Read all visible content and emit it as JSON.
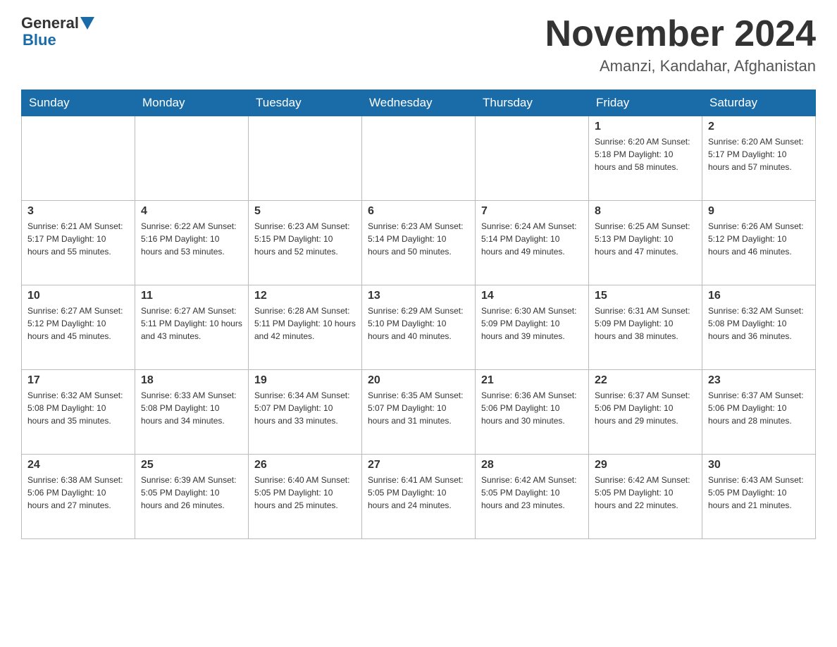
{
  "header": {
    "logo_general": "General",
    "logo_blue": "Blue",
    "month_title": "November 2024",
    "location": "Amanzi, Kandahar, Afghanistan"
  },
  "weekdays": [
    "Sunday",
    "Monday",
    "Tuesday",
    "Wednesday",
    "Thursday",
    "Friday",
    "Saturday"
  ],
  "weeks": [
    [
      {
        "day": "",
        "info": ""
      },
      {
        "day": "",
        "info": ""
      },
      {
        "day": "",
        "info": ""
      },
      {
        "day": "",
        "info": ""
      },
      {
        "day": "",
        "info": ""
      },
      {
        "day": "1",
        "info": "Sunrise: 6:20 AM\nSunset: 5:18 PM\nDaylight: 10 hours and 58 minutes."
      },
      {
        "day": "2",
        "info": "Sunrise: 6:20 AM\nSunset: 5:17 PM\nDaylight: 10 hours and 57 minutes."
      }
    ],
    [
      {
        "day": "3",
        "info": "Sunrise: 6:21 AM\nSunset: 5:17 PM\nDaylight: 10 hours and 55 minutes."
      },
      {
        "day": "4",
        "info": "Sunrise: 6:22 AM\nSunset: 5:16 PM\nDaylight: 10 hours and 53 minutes."
      },
      {
        "day": "5",
        "info": "Sunrise: 6:23 AM\nSunset: 5:15 PM\nDaylight: 10 hours and 52 minutes."
      },
      {
        "day": "6",
        "info": "Sunrise: 6:23 AM\nSunset: 5:14 PM\nDaylight: 10 hours and 50 minutes."
      },
      {
        "day": "7",
        "info": "Sunrise: 6:24 AM\nSunset: 5:14 PM\nDaylight: 10 hours and 49 minutes."
      },
      {
        "day": "8",
        "info": "Sunrise: 6:25 AM\nSunset: 5:13 PM\nDaylight: 10 hours and 47 minutes."
      },
      {
        "day": "9",
        "info": "Sunrise: 6:26 AM\nSunset: 5:12 PM\nDaylight: 10 hours and 46 minutes."
      }
    ],
    [
      {
        "day": "10",
        "info": "Sunrise: 6:27 AM\nSunset: 5:12 PM\nDaylight: 10 hours and 45 minutes."
      },
      {
        "day": "11",
        "info": "Sunrise: 6:27 AM\nSunset: 5:11 PM\nDaylight: 10 hours and 43 minutes."
      },
      {
        "day": "12",
        "info": "Sunrise: 6:28 AM\nSunset: 5:11 PM\nDaylight: 10 hours and 42 minutes."
      },
      {
        "day": "13",
        "info": "Sunrise: 6:29 AM\nSunset: 5:10 PM\nDaylight: 10 hours and 40 minutes."
      },
      {
        "day": "14",
        "info": "Sunrise: 6:30 AM\nSunset: 5:09 PM\nDaylight: 10 hours and 39 minutes."
      },
      {
        "day": "15",
        "info": "Sunrise: 6:31 AM\nSunset: 5:09 PM\nDaylight: 10 hours and 38 minutes."
      },
      {
        "day": "16",
        "info": "Sunrise: 6:32 AM\nSunset: 5:08 PM\nDaylight: 10 hours and 36 minutes."
      }
    ],
    [
      {
        "day": "17",
        "info": "Sunrise: 6:32 AM\nSunset: 5:08 PM\nDaylight: 10 hours and 35 minutes."
      },
      {
        "day": "18",
        "info": "Sunrise: 6:33 AM\nSunset: 5:08 PM\nDaylight: 10 hours and 34 minutes."
      },
      {
        "day": "19",
        "info": "Sunrise: 6:34 AM\nSunset: 5:07 PM\nDaylight: 10 hours and 33 minutes."
      },
      {
        "day": "20",
        "info": "Sunrise: 6:35 AM\nSunset: 5:07 PM\nDaylight: 10 hours and 31 minutes."
      },
      {
        "day": "21",
        "info": "Sunrise: 6:36 AM\nSunset: 5:06 PM\nDaylight: 10 hours and 30 minutes."
      },
      {
        "day": "22",
        "info": "Sunrise: 6:37 AM\nSunset: 5:06 PM\nDaylight: 10 hours and 29 minutes."
      },
      {
        "day": "23",
        "info": "Sunrise: 6:37 AM\nSunset: 5:06 PM\nDaylight: 10 hours and 28 minutes."
      }
    ],
    [
      {
        "day": "24",
        "info": "Sunrise: 6:38 AM\nSunset: 5:06 PM\nDaylight: 10 hours and 27 minutes."
      },
      {
        "day": "25",
        "info": "Sunrise: 6:39 AM\nSunset: 5:05 PM\nDaylight: 10 hours and 26 minutes."
      },
      {
        "day": "26",
        "info": "Sunrise: 6:40 AM\nSunset: 5:05 PM\nDaylight: 10 hours and 25 minutes."
      },
      {
        "day": "27",
        "info": "Sunrise: 6:41 AM\nSunset: 5:05 PM\nDaylight: 10 hours and 24 minutes."
      },
      {
        "day": "28",
        "info": "Sunrise: 6:42 AM\nSunset: 5:05 PM\nDaylight: 10 hours and 23 minutes."
      },
      {
        "day": "29",
        "info": "Sunrise: 6:42 AM\nSunset: 5:05 PM\nDaylight: 10 hours and 22 minutes."
      },
      {
        "day": "30",
        "info": "Sunrise: 6:43 AM\nSunset: 5:05 PM\nDaylight: 10 hours and 21 minutes."
      }
    ]
  ]
}
